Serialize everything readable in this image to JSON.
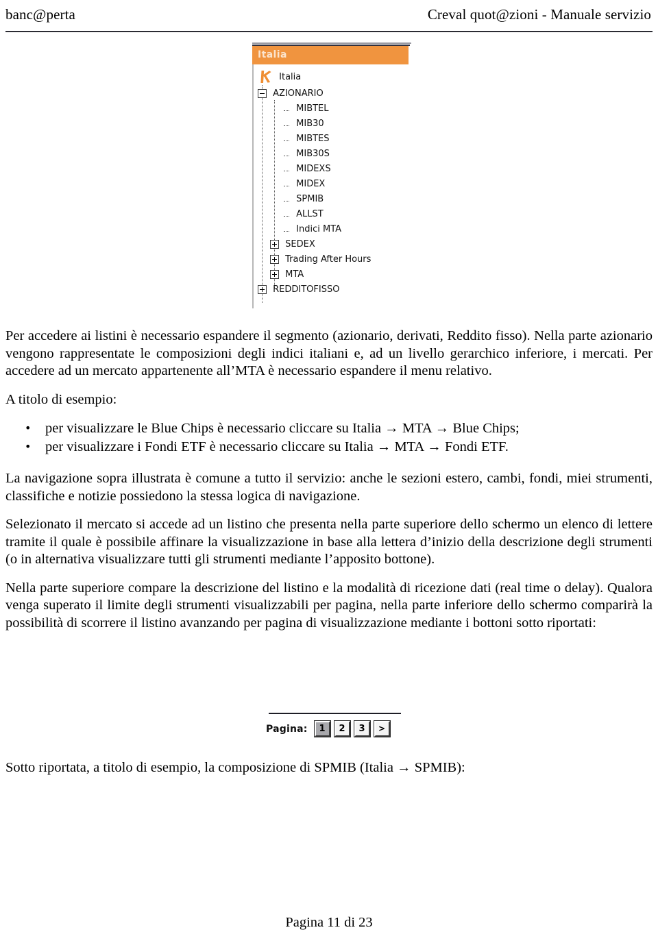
{
  "header": {
    "left": "banc@perta",
    "right": "Creval quot@zioni - Manuale servizio"
  },
  "tree": {
    "title": "Italia",
    "root": {
      "icon": "k-logo-icon",
      "label": "Italia"
    },
    "nodes": [
      {
        "label": "AZIONARIO",
        "level": 0,
        "marker": "minus"
      },
      {
        "label": "MIBTEL",
        "level": 2,
        "marker": "leaf"
      },
      {
        "label": "MIB30",
        "level": 2,
        "marker": "leaf"
      },
      {
        "label": "MIBTES",
        "level": 2,
        "marker": "leaf"
      },
      {
        "label": "MIB30S",
        "level": 2,
        "marker": "leaf"
      },
      {
        "label": "MIDEXS",
        "level": 2,
        "marker": "leaf"
      },
      {
        "label": "MIDEX",
        "level": 2,
        "marker": "leaf"
      },
      {
        "label": "SPMIB",
        "level": 2,
        "marker": "leaf"
      },
      {
        "label": "ALLST",
        "level": 2,
        "marker": "leaf"
      },
      {
        "label": "Indici MTA",
        "level": 2,
        "marker": "leaf"
      },
      {
        "label": "SEDEX",
        "level": 1,
        "marker": "plus"
      },
      {
        "label": "Trading After Hours",
        "level": 1,
        "marker": "plus"
      },
      {
        "label": "MTA",
        "level": 1,
        "marker": "plus"
      },
      {
        "label": "REDDITOFISSO",
        "level": 0,
        "marker": "plus"
      }
    ],
    "accent_color": "#f0943f",
    "header_text_color": "#fbe4cd"
  },
  "body": {
    "p1": "Per accedere ai listini è necessario espandere il segmento (azionario, derivati, Reddito fisso). Nella parte azionario vengono rappresentate le composizioni degli indici italiani e, ad un livello gerarchico inferiore, i mercati. Per accedere ad un mercato appartenente all’MTA è necessario espandere il menu relativo.",
    "p2": "A titolo di esempio:",
    "bullet1": "per visualizzare le Blue Chips è necessario cliccare su Italia → MTA → Blue Chips;",
    "bullet2": "per visualizzare i Fondi ETF è necessario cliccare su Italia → MTA → Fondi ETF.",
    "p3": "La navigazione sopra illustrata è comune a tutto il servizio: anche le sezioni estero, cambi, fondi, miei strumenti, classifiche e notizie possiedono la stessa logica di navigazione.",
    "p4": "Selezionato il mercato si accede ad un listino che presenta nella parte superiore dello schermo un elenco di lettere tramite il quale è possibile affinare la visualizzazione in base alla lettera d’inizio della descrizione degli strumenti (o in alternativa visualizzare tutti gli strumenti mediante l’apposito bottone).",
    "p5": "Nella parte superiore compare la descrizione del listino e la modalità di ricezione dati (real time o delay). Qualora venga superato il limite degli strumenti visualizzabili per pagina, nella parte inferiore dello schermo comparirà la possibilità di scorrere il listino avanzando per pagina di visualizzazione mediante i bottoni sotto riportati:",
    "p6": "Sotto riportata, a titolo di esempio, la composizione di SPMIB (Italia → SPMIB):"
  },
  "pager": {
    "label": "Pagina:",
    "buttons": [
      "1",
      "2",
      "3",
      ">"
    ],
    "active_index": 0
  },
  "footer": {
    "text": "Pagina 11 di 23"
  }
}
